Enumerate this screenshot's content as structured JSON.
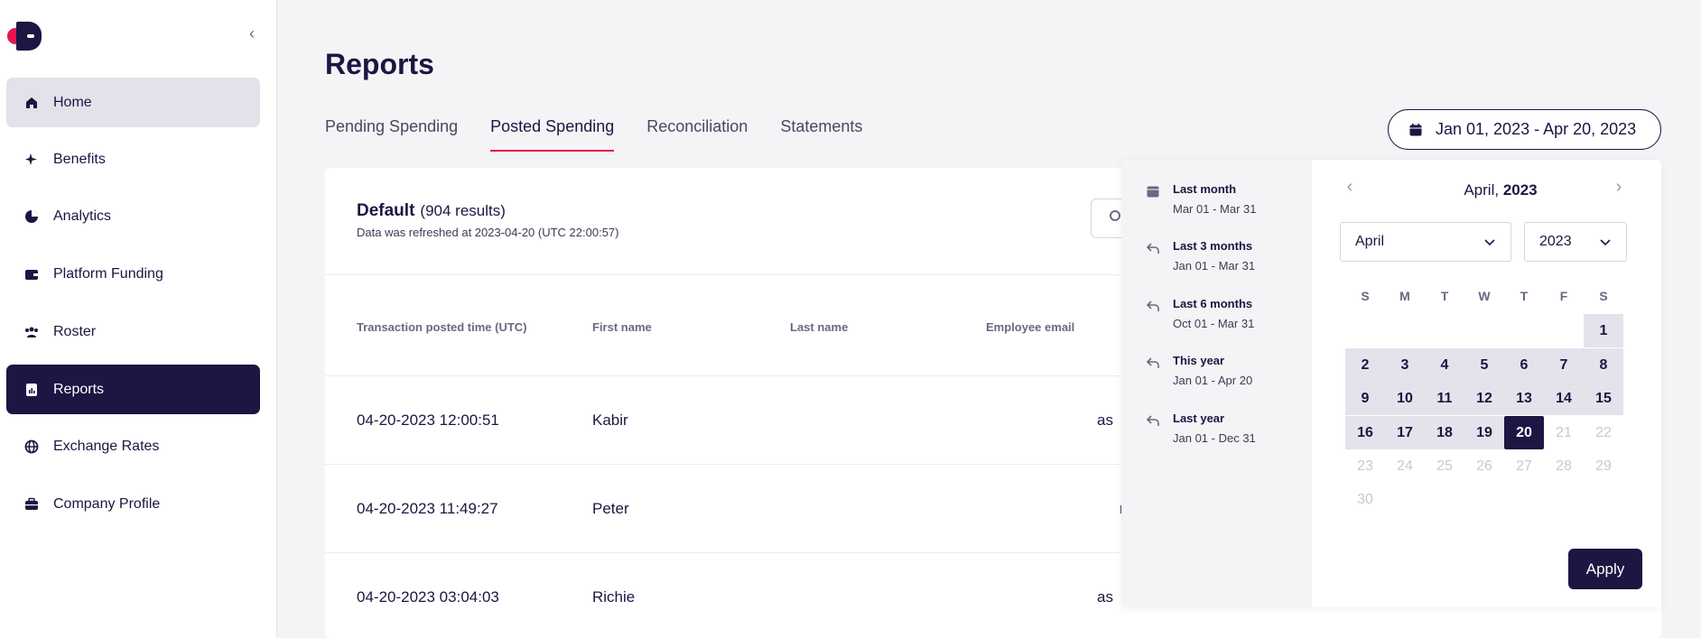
{
  "sidebar": {
    "collapse_icon": "chevron-left-icon",
    "items": [
      {
        "label": "Home",
        "icon": "home-icon"
      },
      {
        "label": "Benefits",
        "icon": "sparkle-icon"
      },
      {
        "label": "Analytics",
        "icon": "pie-chart-icon"
      },
      {
        "label": "Platform Funding",
        "icon": "wallet-icon"
      },
      {
        "label": "Roster",
        "icon": "people-icon"
      },
      {
        "label": "Reports",
        "icon": "report-icon"
      },
      {
        "label": "Exchange Rates",
        "icon": "globe-icon"
      },
      {
        "label": "Company Profile",
        "icon": "briefcase-icon"
      }
    ]
  },
  "page": {
    "title": "Reports",
    "tabs": [
      "Pending Spending",
      "Posted Spending",
      "Reconciliation",
      "Statements"
    ],
    "active_tab": "Posted Spending",
    "date_range": "Jan 01, 2023 - Apr 20, 2023"
  },
  "report": {
    "title": "Default",
    "count": "(904 results)",
    "refreshed": "Data was refreshed at 2023-04-20 (UTC 22:00:57)",
    "columns": [
      "Transaction posted time (UTC)",
      "First name",
      "Last name",
      "Employee email"
    ],
    "rows": [
      {
        "time": "04-20-2023 12:00:51",
        "first": "Kabir",
        "email_fragment": "as"
      },
      {
        "time": "04-20-2023 11:49:27",
        "first": "Peter",
        "email_fragment": "r"
      },
      {
        "time": "04-20-2023 03:04:03",
        "first": "Richie",
        "email_fragment": "as"
      }
    ]
  },
  "picker": {
    "presets": [
      {
        "label": "Last month",
        "range": "Mar 01 - Mar 31",
        "icon": "calendar-icon"
      },
      {
        "label": "Last 3 months",
        "range": "Jan 01 - Mar 31",
        "icon": "undo-arrow-icon"
      },
      {
        "label": "Last 6 months",
        "range": "Oct 01 - Mar 31",
        "icon": "undo-arrow-icon"
      },
      {
        "label": "This year",
        "range": "Jan 01 - Apr 20",
        "icon": "undo-arrow-icon"
      },
      {
        "label": "Last year",
        "range": "Jan 01 - Dec 31",
        "icon": "undo-arrow-icon"
      }
    ],
    "month_label": "April,",
    "year_label": "2023",
    "month_select": "April",
    "year_select": "2023",
    "weekdays": [
      "S",
      "M",
      "T",
      "W",
      "T",
      "F",
      "S"
    ],
    "selected_day": "20",
    "apply_label": "Apply"
  },
  "colors": {
    "brand": "#1b1642",
    "accent": "#e5164b"
  }
}
